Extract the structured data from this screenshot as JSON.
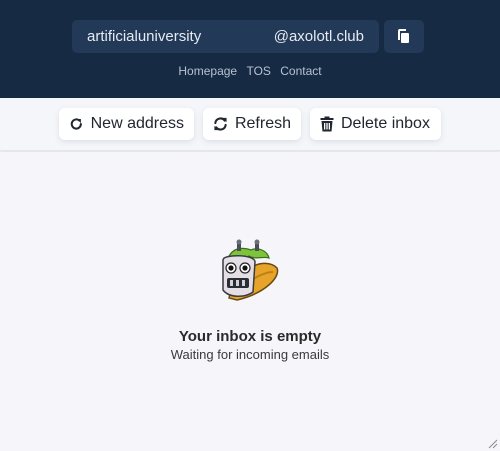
{
  "header": {
    "address_user": "artificialuniversity",
    "address_domain": "@axolotl.club",
    "copy_icon": "copy-icon",
    "links": [
      "Homepage",
      "TOS",
      "Contact"
    ]
  },
  "toolbar": {
    "new_address_label": "New address",
    "refresh_label": "Refresh",
    "delete_inbox_label": "Delete inbox",
    "icons": [
      "redo-icon",
      "refresh-icon",
      "trash-icon"
    ]
  },
  "content": {
    "empty_title": "Your inbox is empty",
    "empty_subtitle": "Waiting for incoming emails",
    "mascot_icon": "taco-robot-icon"
  },
  "colors": {
    "header_bg": "#172a44",
    "field_bg": "#223957",
    "toolbar_bg": "#f5f6f9",
    "page_bg": "#f6f5fa"
  }
}
